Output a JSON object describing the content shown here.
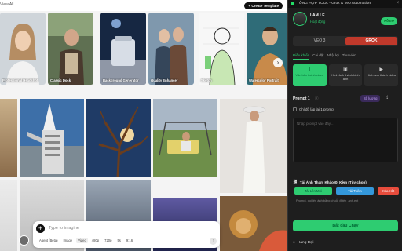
{
  "gallery": {
    "view_all": "View All",
    "create_button": "+ Create Template",
    "templates": [
      {
        "caption": "Professional Headshot",
        "colors": [
          "#c9d2da",
          "#a58a73"
        ]
      },
      {
        "caption": "Classic Dock",
        "colors": [
          "#6c7b5e",
          "#2f3b2b"
        ]
      },
      {
        "caption": "Background Generator",
        "colors": [
          "#182845",
          "#a9b3c4"
        ]
      },
      {
        "caption": "Quality Enhancer",
        "colors": [
          "#3a4d63",
          "#89a3b8"
        ]
      },
      {
        "caption": "Sketch",
        "colors": [
          "#ffffff",
          "#7fd67a"
        ]
      },
      {
        "caption": "Watercolor Portrait",
        "colors": [
          "#2f6e78",
          "#d7b697"
        ]
      }
    ]
  },
  "prompt_bar": {
    "placeholder": "Type to imagine",
    "options": [
      "Agent (Beta)",
      "Image",
      "Video",
      "480p",
      "720p",
      "5s",
      "9:16"
    ],
    "selected_option": "Video"
  },
  "panel": {
    "window_title": "TỔNG HỢP TOOL - Grok & Veo Automation",
    "user": {
      "name": "LÂM LÊ",
      "role": "Hoạt động",
      "mode_button": "Hỗ trợ"
    },
    "engine_tabs": [
      "VEO 3",
      "GROK"
    ],
    "active_engine": "GROK",
    "tabs": [
      "Điều khiển",
      "Cài đặt",
      "Nhật ký",
      "Thư viện"
    ],
    "active_tab": "Điều khiển",
    "modes": [
      {
        "label": "Văn bản thành video",
        "icon": "T"
      },
      {
        "label": "Hình ảnh thành hình ảnh",
        "icon": "▣"
      },
      {
        "label": "Hình ảnh thành video",
        "icon": "▶"
      }
    ],
    "active_mode": 0,
    "prompt": {
      "label": "Prompt 1",
      "info": "ⓘ",
      "count": "Số lượng",
      "checkbox_label": "Chỉ độ lặp lại 1 prompt",
      "placeholder": "Nhập prompt vào đây..."
    },
    "reference": {
      "title": "Tải Ảnh Tham Khảo Đi Kèm (Tùy chọn)",
      "buttons": [
        "Tải Lên Mới",
        "Tải Thêm",
        "Xóa Hết"
      ],
      "hint": "Prompt, gọi lên ảnh bằng chuỗi @tên_ảnh.ext"
    },
    "start_button": "Bắt đầu Chạy",
    "queue_label": "Hàng Đợi"
  }
}
